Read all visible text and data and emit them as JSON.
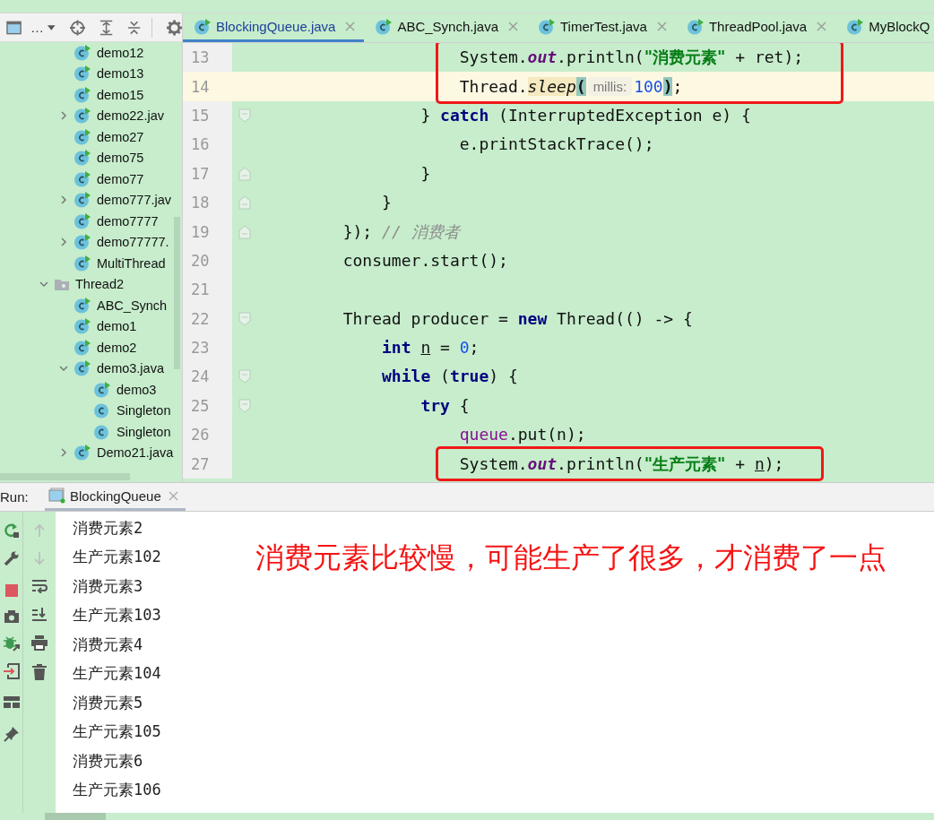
{
  "project_toolbar": {
    "view_label": "…"
  },
  "tree": [
    {
      "kind": "group",
      "children": [
        {
          "label": "demo12",
          "kind": "class",
          "runnable": true
        },
        {
          "label": "demo13",
          "kind": "class",
          "runnable": true
        },
        {
          "label": "demo15",
          "kind": "class",
          "runnable": true
        },
        {
          "label": "demo22.jav",
          "kind": "class",
          "runnable": true,
          "expanded": false
        },
        {
          "label": "demo27",
          "kind": "class",
          "runnable": true
        },
        {
          "label": "demo75",
          "kind": "class",
          "runnable": true
        },
        {
          "label": "demo77",
          "kind": "class",
          "runnable": true
        },
        {
          "label": "demo777.jav",
          "kind": "class",
          "runnable": true,
          "expanded": false
        },
        {
          "label": "demo7777",
          "kind": "class",
          "runnable": true
        },
        {
          "label": "demo77777.",
          "kind": "class",
          "runnable": true,
          "expanded": false
        },
        {
          "label": "MultiThread",
          "kind": "class",
          "runnable": true
        }
      ]
    },
    {
      "label": "Thread2",
      "kind": "folder",
      "expanded": true,
      "children": [
        {
          "label": "ABC_Synch",
          "kind": "class",
          "runnable": true
        },
        {
          "label": "demo1",
          "kind": "class",
          "runnable": true
        },
        {
          "label": "demo2",
          "kind": "class",
          "runnable": true
        },
        {
          "label": "demo3.java",
          "kind": "class",
          "runnable": true,
          "expanded": true,
          "children": [
            {
              "label": "demo3",
              "kind": "class",
              "runnable": true
            },
            {
              "label": "Singleton",
              "kind": "class",
              "runnable": false
            },
            {
              "label": "Singleton",
              "kind": "class",
              "runnable": false
            }
          ]
        },
        {
          "label": "Demo21.java",
          "kind": "class",
          "runnable": true,
          "expanded": false
        }
      ]
    }
  ],
  "tabs": [
    {
      "label": "BlockingQueue.java",
      "selected": true
    },
    {
      "label": "ABC_Synch.java",
      "selected": false
    },
    {
      "label": "TimerTest.java",
      "selected": false
    },
    {
      "label": "ThreadPool.java",
      "selected": false
    },
    {
      "label": "MyBlockQ",
      "selected": false
    }
  ],
  "code_blocks": [
    {
      "boxed": true,
      "lines": [
        {
          "number": "13",
          "current": false,
          "tokens": [
            {
              "kind": "plain",
              "text": "                    System."
            },
            {
              "kind": "static",
              "text": "out"
            },
            {
              "kind": "plain",
              "text": ".println("
            },
            {
              "kind": "string",
              "text": "\"消费元素\""
            },
            {
              "kind": "plain",
              "text": " + ret);"
            }
          ]
        },
        {
          "number": "14",
          "current": true,
          "tokens": [
            {
              "kind": "plain",
              "text": "                    Thread."
            },
            {
              "kind": "method",
              "text": "sleep"
            },
            {
              "kind": "paren",
              "text": "("
            },
            {
              "kind": "hint",
              "text": "millis:"
            },
            {
              "kind": "number",
              "text": "100"
            },
            {
              "kind": "paren",
              "text": ")"
            },
            {
              "kind": "plain",
              "text": ";"
            }
          ]
        }
      ]
    },
    {
      "boxed": false,
      "lines": [
        {
          "number": "15",
          "current": false,
          "kind": "fold-start",
          "tokens": [
            {
              "kind": "plain",
              "text": "                } "
            },
            {
              "kind": "keyword",
              "text": "catch"
            },
            {
              "kind": "plain",
              "text": " (InterruptedException e) {"
            }
          ]
        },
        {
          "number": "16",
          "current": false,
          "tokens": [
            {
              "kind": "plain",
              "text": "                    e.printStackTrace();"
            }
          ]
        },
        {
          "number": "17",
          "current": false,
          "kind": "fold-end",
          "tokens": [
            {
              "kind": "plain",
              "text": "                }"
            }
          ]
        },
        {
          "number": "18",
          "current": false,
          "kind": "fold-end",
          "tokens": [
            {
              "kind": "plain",
              "text": "            }"
            }
          ]
        },
        {
          "number": "19",
          "current": false,
          "kind": "fold-end",
          "tokens": [
            {
              "kind": "plain",
              "text": "        }); "
            },
            {
              "kind": "comment",
              "text": "// 消费者"
            }
          ]
        },
        {
          "number": "20",
          "current": false,
          "tokens": [
            {
              "kind": "plain",
              "text": "        consumer.start();"
            }
          ]
        },
        {
          "number": "21",
          "current": false
        },
        {
          "number": "22",
          "current": false,
          "kind": "fold-start",
          "tokens": [
            {
              "kind": "plain",
              "text": "        Thread producer = "
            },
            {
              "kind": "keyword",
              "text": "new"
            },
            {
              "kind": "plain",
              "text": " Thread(() -> {"
            }
          ]
        },
        {
          "number": "23",
          "current": false,
          "tokens": [
            {
              "kind": "keyword",
              "text": "            int "
            },
            {
              "kind": "variable",
              "text": "n"
            },
            {
              "kind": "plain",
              "text": " = "
            },
            {
              "kind": "number",
              "text": "0"
            },
            {
              "kind": "plain",
              "text": ";"
            }
          ]
        },
        {
          "number": "24",
          "current": false,
          "kind": "fold-start",
          "tokens": [
            {
              "kind": "keyword",
              "text": "            while"
            },
            {
              "kind": "plain",
              "text": " ("
            },
            {
              "kind": "keyword",
              "text": "true"
            },
            {
              "kind": "plain",
              "text": ") {"
            }
          ]
        },
        {
          "number": "25",
          "current": false,
          "kind": "fold-start",
          "tokens": [
            {
              "kind": "keyword",
              "text": "                try"
            },
            {
              "kind": "plain",
              "text": " {"
            }
          ]
        },
        {
          "number": "26",
          "current": false,
          "tokens": [
            {
              "kind": "field",
              "text": "                    queue"
            },
            {
              "kind": "plain",
              "text": ".put(n);"
            }
          ]
        }
      ]
    },
    {
      "boxed": true,
      "lines": [
        {
          "number": "27",
          "current": false,
          "tokens": [
            {
              "kind": "plain",
              "text": "                    System."
            },
            {
              "kind": "static",
              "text": "out"
            },
            {
              "kind": "plain",
              "text": ".println("
            },
            {
              "kind": "string",
              "text": "\"生产元素\""
            },
            {
              "kind": "plain",
              "text": " + "
            },
            {
              "kind": "variable",
              "text": "n"
            },
            {
              "kind": "plain",
              "text": ");"
            }
          ]
        }
      ]
    }
  ],
  "run": {
    "label": "Run:",
    "tab": "BlockingQueue",
    "output": [
      "消费元素2",
      "生产元素102",
      "消费元素3",
      "生产元素103",
      "消费元素4",
      "生产元素104",
      "消费元素5",
      "生产元素105",
      "消费元素6",
      "生产元素106"
    ],
    "annotation": "消费元素比较慢，可能生产了很多，才消费了一点"
  }
}
